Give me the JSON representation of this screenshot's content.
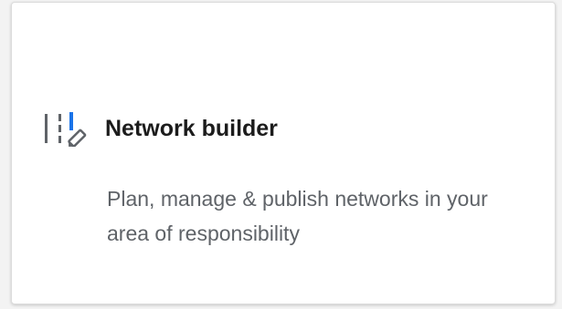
{
  "card": {
    "title": "Network builder",
    "description": "Plan, manage & publish networks in your area of responsibility",
    "icon": "network-builder-icon"
  },
  "colors": {
    "accent": "#1a73e8",
    "title": "#1c1c1c",
    "description": "#5f6368",
    "icon_gray": "#5f6368"
  }
}
